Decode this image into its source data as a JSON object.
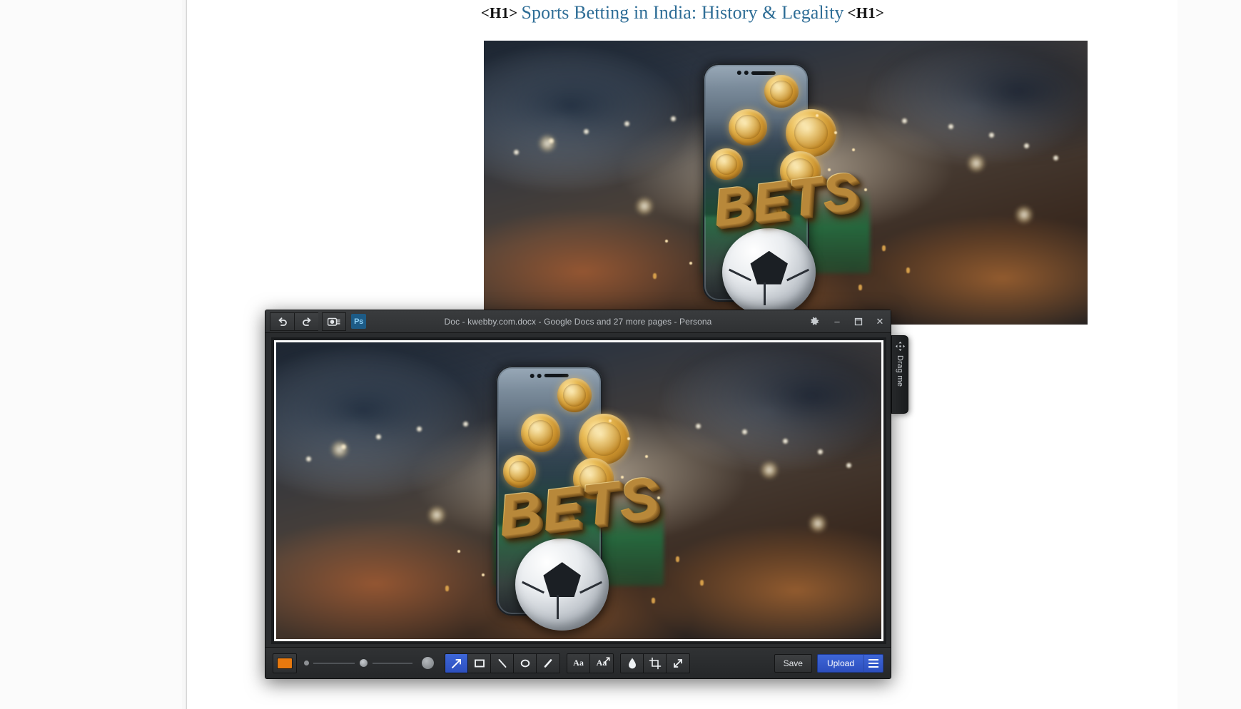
{
  "document": {
    "heading": {
      "open_tag": "<H1>",
      "text": "Sports Betting in India: History & Legality",
      "close_tag": "<H1>",
      "color": "#2e6d96"
    }
  },
  "artwork": {
    "wordmark": "BETS",
    "description": "Sports betting promo: smartphone with gold coins, BETS wordmark and football over blurred stadium"
  },
  "editor": {
    "titlebar": {
      "title": "Doc - kwebby.com.docx - Google Docs and 27 more pages - Persona",
      "undo_label": "Undo",
      "redo_label": "Redo",
      "capture_label": "Capture",
      "photoshop_label": "Ps",
      "settings_label": "Settings",
      "minimize_label": "–",
      "maximize_label": "❐",
      "close_label": "✕"
    },
    "toolbar": {
      "color_swatch": "#e8790e",
      "size_small_label": "Small",
      "size_slider_label": "Stroke size",
      "size_large_label": "Large",
      "tools": [
        {
          "name": "arrow-tool",
          "label": "Arrow",
          "active": true
        },
        {
          "name": "rectangle-tool",
          "label": "Rectangle",
          "active": false
        },
        {
          "name": "line-tool",
          "label": "Line",
          "active": false
        },
        {
          "name": "ellipse-tool",
          "label": "Ellipse",
          "active": false
        },
        {
          "name": "highlighter-tool",
          "label": "Highlighter",
          "active": false
        }
      ],
      "text_tools": [
        {
          "name": "text-tool",
          "label": "Aa"
        },
        {
          "name": "text-callout-tool",
          "label": "Aa"
        }
      ],
      "extra_tools": [
        {
          "name": "blur-tool",
          "label": "Blur"
        },
        {
          "name": "crop-tool",
          "label": "Crop"
        },
        {
          "name": "resize-tool",
          "label": "Resize"
        }
      ],
      "save_label": "Save",
      "upload_label": "Upload",
      "menu_label": "Menu"
    },
    "drag_handle": {
      "label": "Drag me"
    }
  },
  "colors": {
    "accent_blue": "#2c4fbe",
    "heading_blue": "#2e6d96",
    "swatch_orange": "#e8790e",
    "window_chrome": "#2f3133"
  }
}
